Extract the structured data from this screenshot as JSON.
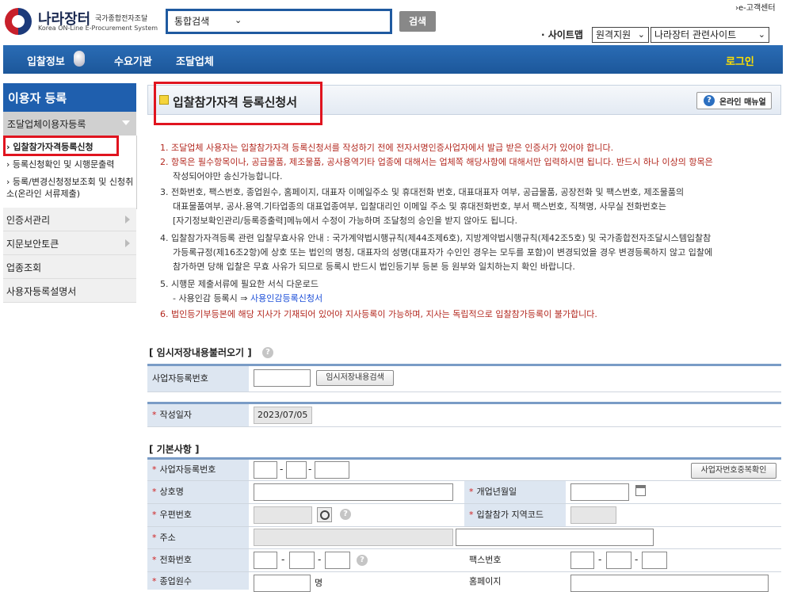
{
  "header": {
    "logo_title": "나라장터",
    "logo_sub_kr": "국가종합전자조달",
    "logo_sub_en": "Korea ON-Line E-Procurement System",
    "search_select": "통합검색",
    "search_button": "검색",
    "top_link": "›e-고객센터",
    "sitemap": "· 사이트맵",
    "select_region": "원격지원",
    "select_related": "나라장터 관련사이트"
  },
  "nav": {
    "items": [
      "입찰정보",
      "수요기관",
      "조달업체"
    ],
    "login": "로그인"
  },
  "sidebar": {
    "title": "이용자 등록",
    "sub": "조달업체이용자등록",
    "items": [
      "› 입찰참가자격등록신청",
      "› 등록신청확인 및 시행문출력",
      "› 등록/변경신청정보조회 및 신청취소(온라인 서류제출)"
    ],
    "menus": [
      "인증서관리",
      "지문보안토큰",
      "업종조회",
      "사용자등록설명서"
    ]
  },
  "main": {
    "title": "입찰참가자격 등록신청서",
    "manual_button": "온라인 매뉴얼",
    "notices": [
      "1. 조달업체 사용자는 입찰참가자격 등록신청서를 작성하기 전에 전자서명인증사업자에서 발급 받은 인증서가 있어야 합니다.",
      "2. 항목은 필수항목이나, 공급물품, 제조물품, 공사용역기타 업종에 대해서는 업체쪽 해당사항에 대해서만 입력하시면 됩니다. 반드시 하나 이상의 항목은",
      "작성되어야만 송신가능합니다.",
      "3. 전화번호, 팩스번호, 종업원수, 홈페이지, 대표자 이메일주소 및 휴대전화 번호, 대표대표자 여부, 공급물품, 공장전화 및 팩스번호, 제조물품의",
      "대표물품여부, 공사.용역.기타업종의 대표업종여부, 입찰대리인 이메일 주소 및 휴대전화번호, 부서 팩스번호, 직책명, 사무실 전화번호는",
      "[자기정보확인관리/등록증출력]메뉴에서 수정이 가능하며 조달청의 승인을 받지 않아도 됩니다.",
      "4. 입찰참가자격등록 관련 입찰무효사유 안내 : 국가계약법시행규칙(제44조제6호), 지방계약법시행규칙(제42조5호) 및 국가종합전자조달시스템입찰참",
      "가등록규정(제16조2항)에 상호 또는 법인의 명칭, 대표자의 성명(대표자가 수인인 경우는 모두를 포함)이 변경되었을 경우 변경등록하지 않고 입찰에",
      "참가하면 당해 입찰은 무효 사유가 되므로 등록시 반드시 법인등기부 등본 등 원부와 일치하는지 확인 바랍니다.",
      "5. 시행문 제출서류에 필요한 서식 다운로드",
      "- 사용인감 등록시 ⇒ ",
      "6. 법인등기부등본에 해당 지사가 기재되어 있어야 지사등록이 가능하며, 지사는 독립적으로 입찰참가등록이 불가합니다."
    ],
    "notice_link": "사용인감등록신청서",
    "temp_section": "[ 임시저장내용불러오기 ]",
    "temp_label": "사업자등록번호",
    "temp_button": "임시저장내용검색",
    "date_label": "작성일자",
    "date_value": "2023/07/05",
    "basic_section": "[ 기본사항 ]",
    "labels": {
      "bizno": "사업자등록번호",
      "dup_button": "사업자번호중복확인",
      "company": "상호명",
      "open_date": "개업년월일",
      "zip": "우편번호",
      "region_code": "입찰참가 지역코드",
      "address": "주소",
      "phone": "전화번호",
      "fax": "팩스번호",
      "employees": "종업원수",
      "employees_unit": "명",
      "homepage": "홈페이지"
    }
  }
}
